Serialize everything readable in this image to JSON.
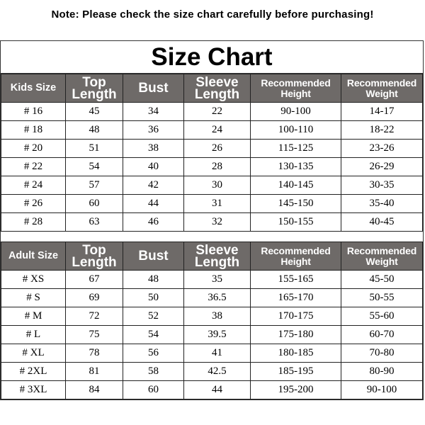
{
  "note": "Note: Please check the size chart carefully before purchasing!",
  "title": "Size Chart",
  "kids": {
    "headers": [
      "Kids Size",
      "Top Length",
      "Bust",
      "Sleeve Length",
      "Recommended Height",
      "Recommended Weight"
    ],
    "header_lines": [
      [
        "Kids Size"
      ],
      [
        "Top",
        "Length"
      ],
      [
        "Bust"
      ],
      [
        "Sleeve",
        "Length"
      ],
      [
        "Recommended",
        "Height"
      ],
      [
        "Recommended",
        "Weight"
      ]
    ],
    "rows": [
      [
        "# 16",
        "45",
        "34",
        "22",
        "90-100",
        "14-17"
      ],
      [
        "# 18",
        "48",
        "36",
        "24",
        "100-110",
        "18-22"
      ],
      [
        "# 20",
        "51",
        "38",
        "26",
        "115-125",
        "23-26"
      ],
      [
        "# 22",
        "54",
        "40",
        "28",
        "130-135",
        "26-29"
      ],
      [
        "# 24",
        "57",
        "42",
        "30",
        "140-145",
        "30-35"
      ],
      [
        "# 26",
        "60",
        "44",
        "31",
        "145-150",
        "35-40"
      ],
      [
        "# 28",
        "63",
        "46",
        "32",
        "150-155",
        "40-45"
      ]
    ]
  },
  "adult": {
    "headers": [
      "Adult Size",
      "Top Length",
      "Bust",
      "Sleeve Length",
      "Recommended Height",
      "Recommended Weight"
    ],
    "header_lines": [
      [
        "Adult Size"
      ],
      [
        "Top",
        "Length"
      ],
      [
        "Bust"
      ],
      [
        "Sleeve",
        "Length"
      ],
      [
        "Recommended",
        "Height"
      ],
      [
        "Recommended",
        "Weight"
      ]
    ],
    "rows": [
      [
        "# XS",
        "67",
        "48",
        "35",
        "155-165",
        "45-50"
      ],
      [
        "# S",
        "69",
        "50",
        "36.5",
        "165-170",
        "50-55"
      ],
      [
        "# M",
        "72",
        "52",
        "38",
        "170-175",
        "55-60"
      ],
      [
        "# L",
        "75",
        "54",
        "39.5",
        "175-180",
        "60-70"
      ],
      [
        "# XL",
        "78",
        "56",
        "41",
        "180-185",
        "70-80"
      ],
      [
        "# 2XL",
        "81",
        "58",
        "42.5",
        "185-195",
        "80-90"
      ],
      [
        "# 3XL",
        "84",
        "60",
        "44",
        "195-200",
        "90-100"
      ]
    ]
  },
  "colors": {
    "header_bg": "#6e6a68",
    "header_text": "#ffffff",
    "border": "#222222"
  }
}
